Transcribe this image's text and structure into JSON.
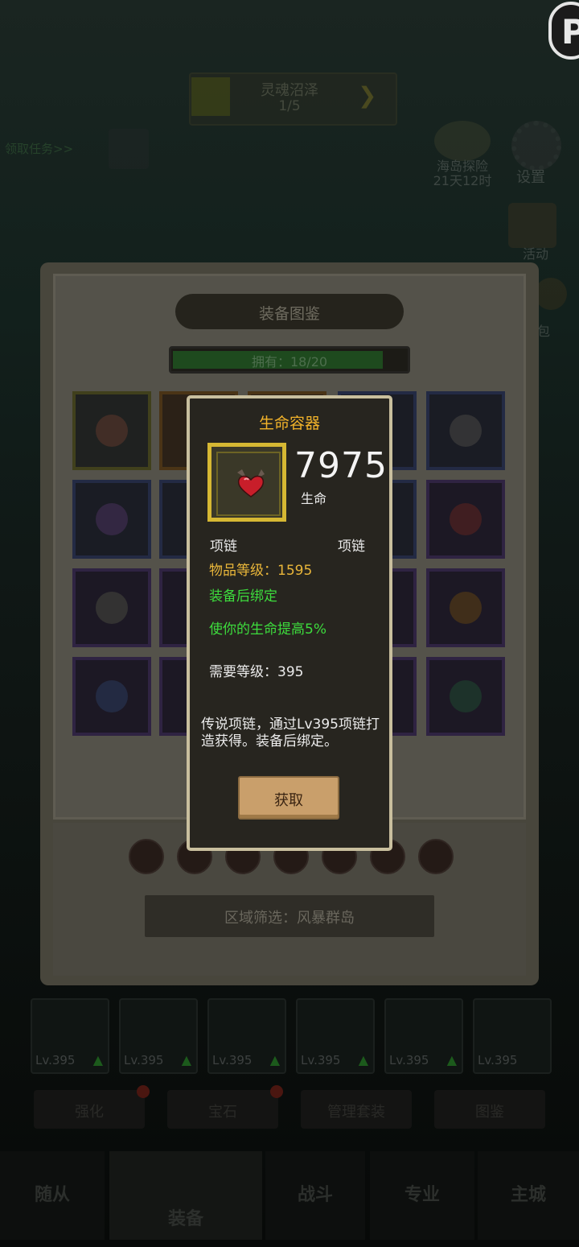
{
  "top_badge": "P",
  "hud": {
    "quest_title": "灵魂沼泽",
    "quest_progress": "1/5",
    "task_link": "领取任务>>",
    "event_name": "海岛探险",
    "event_time": "21天12时",
    "settings_label": "设置",
    "activity_label": "活动",
    "bag_label": "包"
  },
  "codex": {
    "title": "装备图鉴",
    "owned": "拥有：18/20",
    "owned_fraction": 0.9,
    "filter": "区域筛选：风暴群岛"
  },
  "tooltip": {
    "name": "生命容器",
    "value": "7975",
    "stat": "生命",
    "slot_left": "项链",
    "slot_right": "项链",
    "item_level": "物品等级：1595",
    "bind": "装备后绑定",
    "effect": "使你的生命提高5%",
    "required_level": "需要等级：395",
    "description": "传说项链，通过Lv395项链打造获得。装备后绑定。",
    "button": "获取"
  },
  "equipment": [
    {
      "level": "Lv.395"
    },
    {
      "level": "Lv.395"
    },
    {
      "level": "Lv.395"
    },
    {
      "level": "Lv.395"
    },
    {
      "level": "Lv.395"
    },
    {
      "level": "Lv.395"
    }
  ],
  "tabs": {
    "enhance": "强化",
    "gem": "宝石",
    "manage": "管理套装",
    "codex": "图鉴"
  },
  "nav": {
    "followers": "随从",
    "equipment": "装备",
    "battle": "战斗",
    "profession": "专业",
    "city": "主城"
  }
}
